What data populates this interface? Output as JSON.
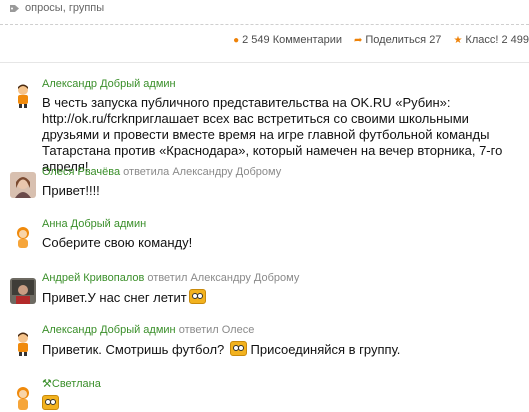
{
  "tags": {
    "label": "опросы, группы"
  },
  "stats": {
    "comments": "2 549 Комментарии",
    "shares": "Поделиться 27",
    "likes": "Класс! 2 499"
  },
  "comments": [
    {
      "author": "Александр Добрый админ",
      "reply_to": "",
      "text": "В честь запуска публичного представительства на OK.RU «Рубин»: http://ok.ru/fcrkприглашает всех вас встретиться со своими школьными друзьями и провести вместе время на игре главной футбольной команды Татарстана против «Краснодара», который намечен на вечер вторника, 7-го апреля!"
    },
    {
      "author": "Олеся Рвачёва",
      "reply_to": "ответила Александру Доброму",
      "text": "Привет!!!!"
    },
    {
      "author": "Анна Добрый админ",
      "reply_to": "",
      "text": "Соберите свою команду!"
    },
    {
      "author": "Андрей Кривопалов",
      "reply_to": "ответил Александру Доброму",
      "text": "Привет.У нас снег летит"
    },
    {
      "author": "Александр Добрый админ",
      "reply_to": "ответил Олесе",
      "text_a": "Приветик. Смотришь футбол?",
      "text_b": "Присоединяйся в группу."
    },
    {
      "author": "Светлана",
      "reply_to": "",
      "text": ""
    }
  ],
  "colors": {
    "name": "#3a8f2a",
    "accent": "#ee8208"
  }
}
